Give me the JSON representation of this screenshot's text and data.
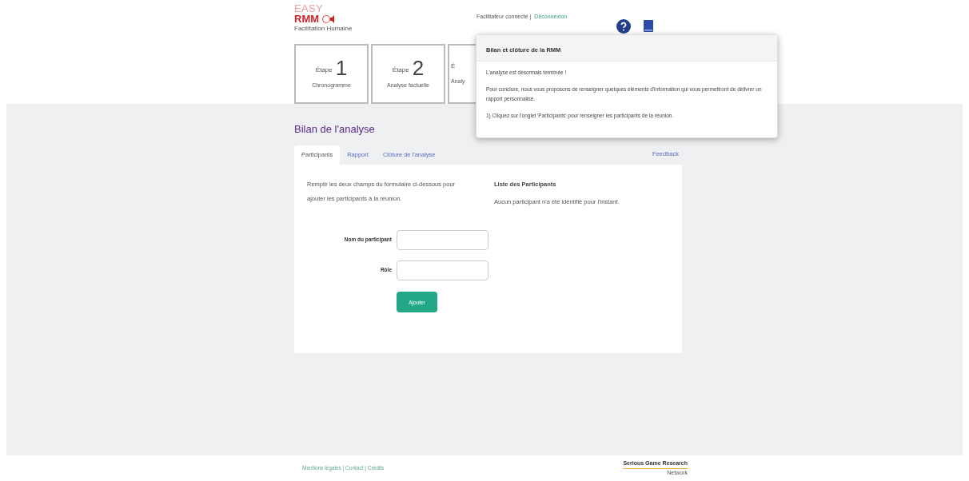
{
  "logo": {
    "top": "EASY",
    "main": "RMM",
    "tagline": "Facilitation Humaine"
  },
  "header": {
    "user": "Facilitateur connecté |",
    "logout": "Déconnexion"
  },
  "steps": [
    {
      "prefix": "Étape",
      "number": "1",
      "label": "Chronogramme"
    },
    {
      "prefix": "Étape",
      "number": "2",
      "label": "Analyse factuelle"
    },
    {
      "prefix": "É",
      "label": "Analy"
    }
  ],
  "popover": {
    "title": "Bilan et clôture de la RMM",
    "paragraphs": [
      "L'analyse est désormais terminée !",
      "Pour conclure, nous vous proposons de renseigner quelques éléments d'information qui vous permettront de délivrer un rapport personnalisé.",
      "1) Cliquez sur l'onglet 'Participants' pour renseigner les participants de la réunion."
    ]
  },
  "page_title": "Bilan de l'analyse",
  "tabs": [
    {
      "label": "Participants",
      "selected": true
    },
    {
      "label": "Rapport",
      "selected": false
    },
    {
      "label": "Clôture de l'analyse",
      "selected": false
    }
  ],
  "feedback": "Feedback",
  "instructions": "Remplir les deux champs du formulaire ci-dessous pour ajouter les participants à la réunion.",
  "participants": {
    "title": "Liste des Participants",
    "empty": "Aucun participant n'a été identifié pour l'instant."
  },
  "form": {
    "fields": [
      {
        "label": "Nom du participant"
      },
      {
        "label": "Rôle"
      }
    ],
    "submit": "Ajouter"
  },
  "footer": {
    "links": "Mentions légales | Contact | Crédits",
    "brand": "Serious Game Research",
    "brand_sub": "Network"
  }
}
